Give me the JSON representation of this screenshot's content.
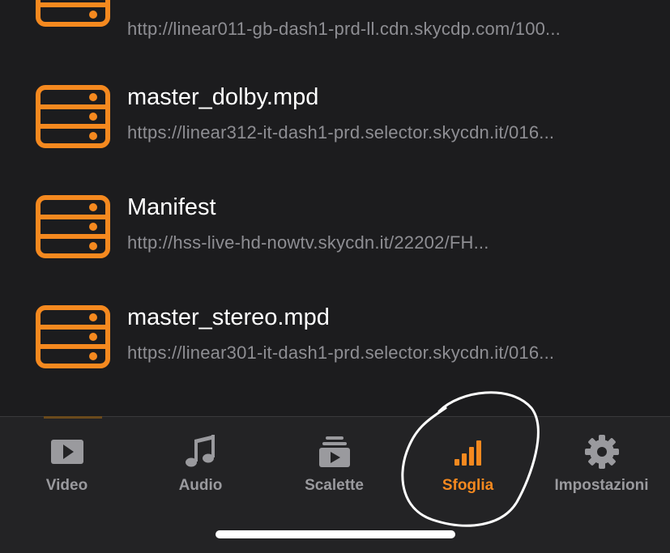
{
  "accent_color": "#f5891f",
  "items": [
    {
      "title": "",
      "url": "http://linear011-gb-dash1-prd-ll.cdn.skycdp.com/100..."
    },
    {
      "title": "master_dolby.mpd",
      "url": "https://linear312-it-dash1-prd.selector.skycdn.it/016..."
    },
    {
      "title": "Manifest",
      "url": "http://hss-live-hd-nowtv.skycdn.it/22202/FH..."
    },
    {
      "title": "master_stereo.mpd",
      "url": "https://linear301-it-dash1-prd.selector.skycdn.it/016..."
    }
  ],
  "tabs": [
    {
      "label": "Video",
      "icon": "video-icon"
    },
    {
      "label": "Audio",
      "icon": "music-note-icon"
    },
    {
      "label": "Scalette",
      "icon": "playlist-icon"
    },
    {
      "label": "Sfoglia",
      "icon": "network-bars-icon",
      "active": true
    },
    {
      "label": "Impostazioni",
      "icon": "gear-icon"
    }
  ]
}
